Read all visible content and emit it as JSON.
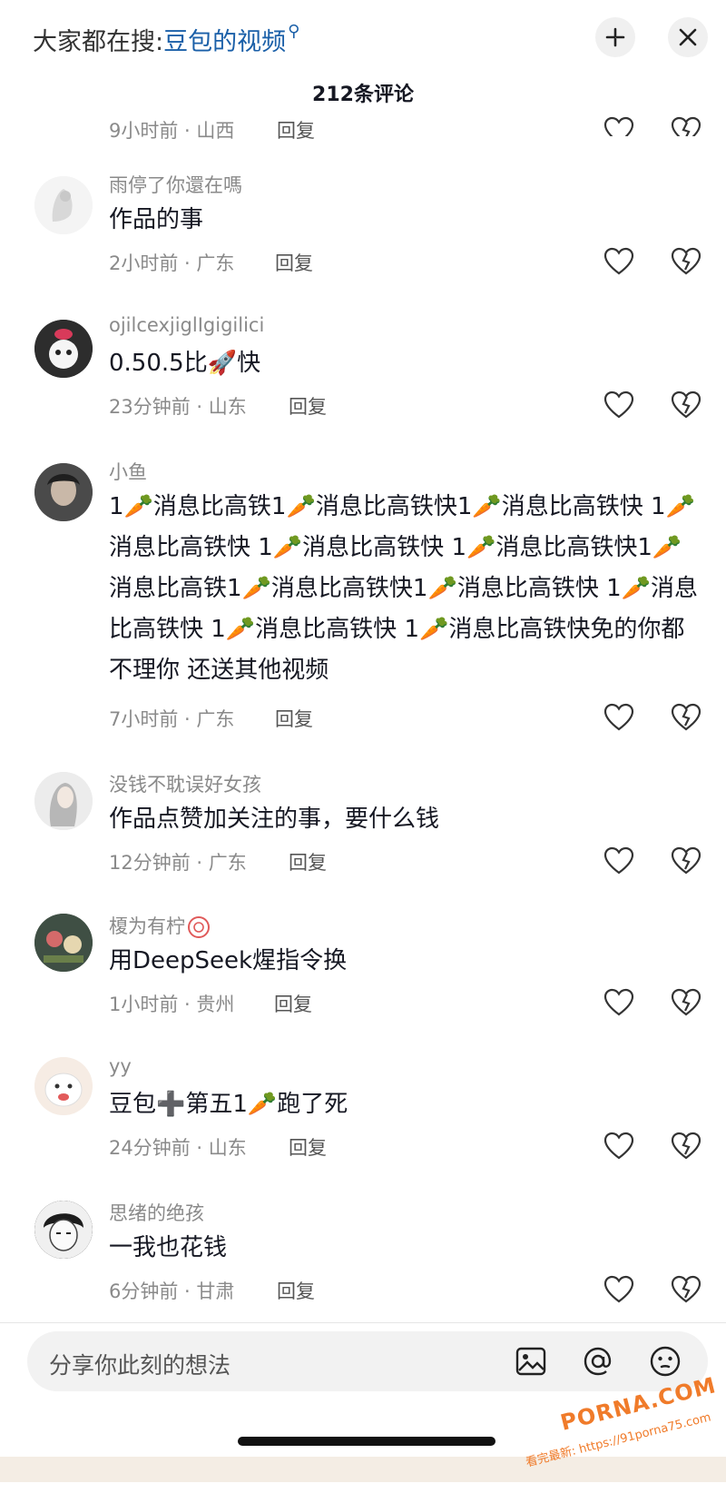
{
  "header": {
    "search_prefix": "大家都在搜:",
    "search_term": "豆包的视频",
    "title": "212条评论"
  },
  "cutoff": {
    "meta": "9小时前 · 山西",
    "reply": "回复"
  },
  "comments": [
    {
      "username": "雨停了你還在嗎",
      "text": "作品的事",
      "meta": "2小时前 · 广东",
      "reply": "回复"
    },
    {
      "username": "ojilcexjiglIgigilici",
      "text": "0.50.5比🚀快",
      "meta": "23分钟前 · 山东",
      "reply": "回复"
    },
    {
      "username": "小鱼",
      "text": "1🥕消息比高铁1🥕消息比高铁快1🥕消息比高铁快 1🥕消息比高铁快 1🥕消息比高铁快 1🥕消息比高铁快1🥕消息比高铁1🥕消息比高铁快1🥕消息比高铁快 1🥕消息比高铁快 1🥕消息比高铁快 1🥕消息比高铁快免的你都不理你 还送其他视频",
      "meta": "7小时前 · 广东",
      "reply": "回复"
    },
    {
      "username": "没钱不耽误好女孩",
      "text": "作品点赞加关注的事，要什么钱",
      "meta": "12分钟前 · 广东",
      "reply": "回复"
    },
    {
      "username": "榎为有柠",
      "text": "用DeepSeek煋指令换",
      "meta": "1小时前 · 贵州",
      "reply": "回复"
    },
    {
      "username": "yy",
      "text": "豆包➕第五1🥕跑了死",
      "meta": "24分钟前 · 山东",
      "reply": "回复"
    },
    {
      "username": "思绪的绝孩",
      "text": "一我也花钱",
      "meta": "6分钟前 · 甘肃",
      "reply": "回复"
    }
  ],
  "input": {
    "placeholder": "分享你此刻的想法"
  },
  "watermark": {
    "logo": "PORNA.COM",
    "url": "看完最新: https://91porna75.com"
  },
  "colors": {
    "link": "#1a5fa8",
    "muted": "#8a8a8a",
    "text": "#161823",
    "watermark": "#f07b2a"
  },
  "icons": [
    "search-icon",
    "add-icon",
    "close-icon",
    "heart-icon",
    "dislike-heart-icon",
    "image-icon",
    "at-icon",
    "emoji-icon"
  ]
}
